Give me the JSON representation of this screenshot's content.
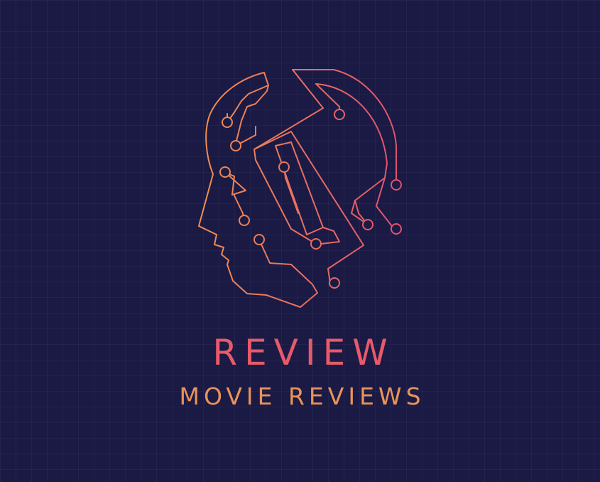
{
  "brand": {
    "name": "REVIEW",
    "tagline": "MOVIE REVIEWS"
  },
  "logo": {
    "icon": "circuit-head-icon"
  },
  "colors": {
    "background": "#1a1a44",
    "name": "#e85a6a",
    "tagline": "#e9935a",
    "gradient_start": "#f08a4e",
    "gradient_end": "#e0506e"
  }
}
